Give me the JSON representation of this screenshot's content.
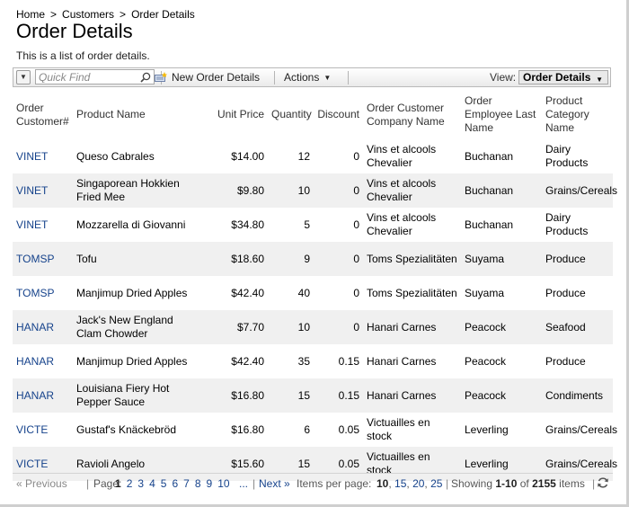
{
  "breadcrumb": {
    "home": "Home",
    "sep1": ">",
    "customers": "Customers",
    "sep2": ">",
    "current": "Order Details"
  },
  "page": {
    "title": "Order Details",
    "description": "This is a list of order details."
  },
  "toolbar": {
    "quick_find_placeholder": "Quick Find",
    "new_label": "New Order Details",
    "actions_label": "Actions",
    "view_label": "View:",
    "view_value": "Order Details",
    "icons": {
      "toggle": "collapse-icon",
      "search": "search-icon",
      "new": "new-record-icon",
      "dropdown": "chevron-down-icon"
    }
  },
  "grid": {
    "columns": [
      "Order Customer#",
      "Product Name",
      "Unit Price",
      "Quantity",
      "Discount",
      "Order Customer Company Name",
      "Order Employee Last Name",
      "Product Category Name"
    ],
    "rows": [
      {
        "customer": "VINET",
        "product": "Queso Cabrales",
        "price": "$14.00",
        "qty": "12",
        "discount": "0",
        "company": "Vins et alcools Chevalier",
        "employee": "Buchanan",
        "category": "Dairy Products"
      },
      {
        "customer": "VINET",
        "product": "Singaporean Hokkien Fried Mee",
        "price": "$9.80",
        "qty": "10",
        "discount": "0",
        "company": "Vins et alcools Chevalier",
        "employee": "Buchanan",
        "category": "Grains/Cereals"
      },
      {
        "customer": "VINET",
        "product": "Mozzarella di Giovanni",
        "price": "$34.80",
        "qty": "5",
        "discount": "0",
        "company": "Vins et alcools Chevalier",
        "employee": "Buchanan",
        "category": "Dairy Products"
      },
      {
        "customer": "TOMSP",
        "product": "Tofu",
        "price": "$18.60",
        "qty": "9",
        "discount": "0",
        "company": "Toms Spezialitäten",
        "employee": "Suyama",
        "category": "Produce"
      },
      {
        "customer": "TOMSP",
        "product": "Manjimup Dried Apples",
        "price": "$42.40",
        "qty": "40",
        "discount": "0",
        "company": "Toms Spezialitäten",
        "employee": "Suyama",
        "category": "Produce"
      },
      {
        "customer": "HANAR",
        "product": "Jack's New England Clam Chowder",
        "price": "$7.70",
        "qty": "10",
        "discount": "0",
        "company": "Hanari Carnes",
        "employee": "Peacock",
        "category": "Seafood"
      },
      {
        "customer": "HANAR",
        "product": "Manjimup Dried Apples",
        "price": "$42.40",
        "qty": "35",
        "discount": "0.15",
        "company": "Hanari Carnes",
        "employee": "Peacock",
        "category": "Produce"
      },
      {
        "customer": "HANAR",
        "product": "Louisiana Fiery Hot Pepper Sauce",
        "price": "$16.80",
        "qty": "15",
        "discount": "0.15",
        "company": "Hanari Carnes",
        "employee": "Peacock",
        "category": "Condiments"
      },
      {
        "customer": "VICTE",
        "product": "Gustaf's Knäckebröd",
        "price": "$16.80",
        "qty": "6",
        "discount": "0.05",
        "company": "Victuailles en stock",
        "employee": "Leverling",
        "category": "Grains/Cereals"
      },
      {
        "customer": "VICTE",
        "product": "Ravioli Angelo",
        "price": "$15.60",
        "qty": "15",
        "discount": "0.05",
        "company": "Victuailles en stock",
        "employee": "Leverling",
        "category": "Grains/Cereals"
      }
    ]
  },
  "pager": {
    "previous": "« Previous",
    "sep": "|",
    "page_label": "Page:",
    "pages": [
      "1",
      "2",
      "3",
      "4",
      "5",
      "6",
      "7",
      "8",
      "9",
      "10"
    ],
    "current_page": "1",
    "ellipsis": "...",
    "next": "Next »",
    "items_per_page_label": "Items per page:",
    "sizes": [
      "10",
      "15",
      "20",
      "25"
    ],
    "showing_label": "Showing",
    "showing_range": "1-10",
    "of_label": "of",
    "total": "2155",
    "items_label": "items",
    "refresh_icon": "refresh-icon"
  }
}
